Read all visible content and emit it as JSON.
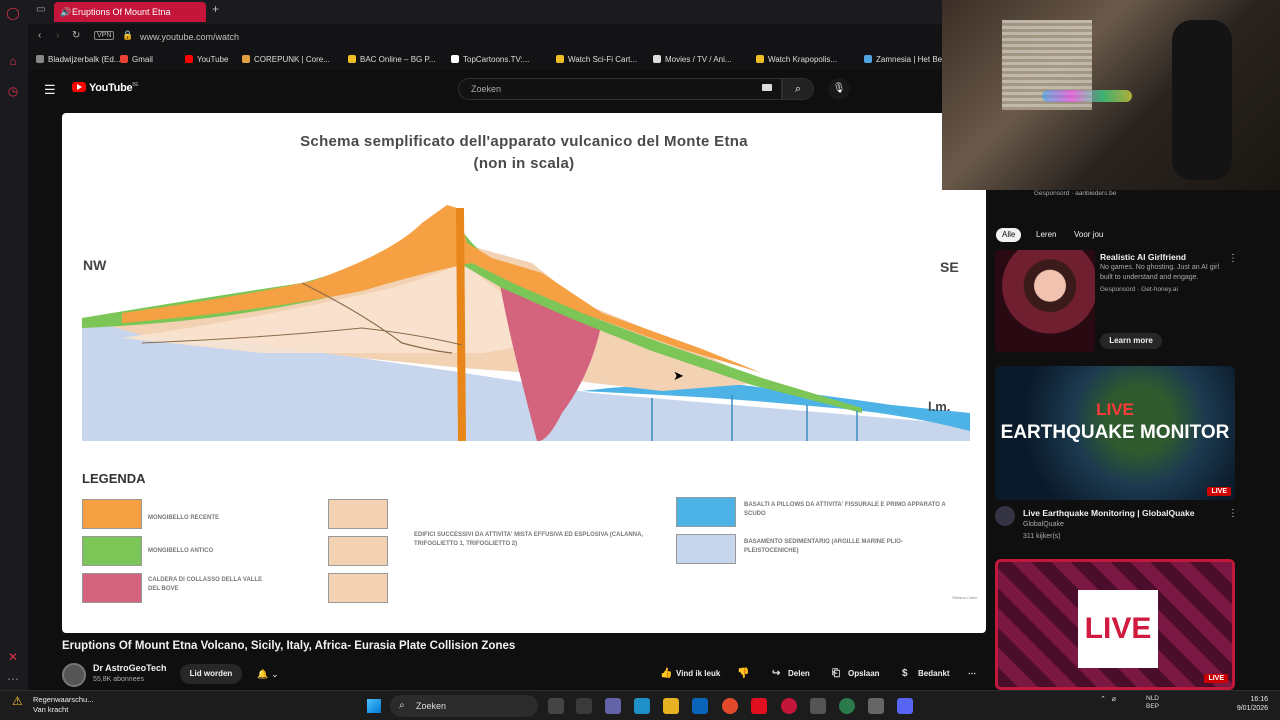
{
  "browser": {
    "tab_title": "Eruptions Of Mount Etna",
    "url": "www.youtube.com/watch",
    "vpn_label": "VPN",
    "bookmarks": [
      {
        "label": "Bladwijzerbalk (Ed...",
        "color": "#888888"
      },
      {
        "label": "Gmail",
        "color": "#ea4335"
      },
      {
        "label": "YouTube",
        "color": "#ff0000"
      },
      {
        "label": "COREPUNK | Core...",
        "color": "#e0a040"
      },
      {
        "label": "BAC Online – BG P...",
        "color": "#f0c020"
      },
      {
        "label": "TopCartoons.TV:...",
        "color": "#ffffff"
      },
      {
        "label": "Watch Sci-Fi Cart...",
        "color": "#f0c020"
      },
      {
        "label": "Movies / TV / Ani...",
        "color": "#dddddd"
      },
      {
        "label": "Watch Krapopolis...",
        "color": "#f0c020"
      },
      {
        "label": "Zamnesia | Het Be",
        "color": "#4fa3e0"
      }
    ]
  },
  "youtube": {
    "logo_text": "YouTube",
    "region": "BE",
    "search_placeholder": "Zoeken"
  },
  "diagram": {
    "title_line1": "Schema semplificato dell'apparato vulcanico del Monte Etna",
    "title_line2": "(non in scala)",
    "left_dir": "NW",
    "right_dir": "SE",
    "sea_level": "l.m.",
    "legend_title": "LEGENDA",
    "legend_items": [
      {
        "label": "MONGIBELLO RECENTE",
        "color": "#f5a043"
      },
      {
        "label": "MONGIBELLO ANTICO",
        "color": "#7cc557"
      },
      {
        "label": "CALDERA DI COLLASSO DELLA VALLE DEL BOVE",
        "color": "#d4637e"
      },
      {
        "label": "EDIFICI SUCCESSIVI DA ATTIVITA' MISTA EFFUSIVA ED ESPLOSIVA (CALANNA, TRIFOGLIETTO 1, TRIFOGLIETTO 2)",
        "color": "#f3d2b4"
      },
      {
        "label": "BASALTI A PILLOWS DA ATTIVITA' FISSURALE E PRIMO APPARATO A SCUDO",
        "color": "#4db3e6"
      },
      {
        "label": "BASAMENTO SEDIMENTARIO (ARGILLE MARINE PLIO-PLEISTOCENICHE)",
        "color": "#c7d6ec"
      }
    ],
    "watermark": "Stefano Carta"
  },
  "video": {
    "title": "Eruptions Of Mount Etna Volcano, Sicily, Italy, Africa- Eurasia Plate Collision Zones",
    "channel": "Dr AstroGeoTech",
    "subscribers": "55,8K abonnees",
    "join_label": "Lid worden",
    "like_label": "Vind ik leuk",
    "share_label": "Delen",
    "save_label": "Opslaan",
    "thanks_label": "Bedankt"
  },
  "sidebar": {
    "sponsored_line": "Gesponsord · aanbieders.be",
    "chips": [
      "Alle",
      "Leren",
      "Voor jou"
    ],
    "ad": {
      "title": "Realistic AI Girlfriend",
      "description": "No games. No ghosting. Just an AI girl built to understand and engage.",
      "sponsored": "Gesponsord · Get-honey.ai",
      "cta": "Learn more"
    },
    "rec1": {
      "thumb_live": "LIVE",
      "thumb_text": "EARTHQUAKE MONITOR",
      "live_badge": "LIVE",
      "title": "Live Earthquake Monitoring | GlobalQuake",
      "channel": "GlobalQuake",
      "viewers": "311 kijker(s)"
    },
    "rec2": {
      "thumb_text": "LIVE",
      "live_badge": "LIVE"
    }
  },
  "taskbar": {
    "weather_line1": "Regenwaarschu...",
    "weather_line2": "Van kracht",
    "search_label": "Zoeken",
    "lang_line1": "NLD",
    "lang_line2": "BEP",
    "time": "16:16",
    "date": "9/01/2026"
  }
}
